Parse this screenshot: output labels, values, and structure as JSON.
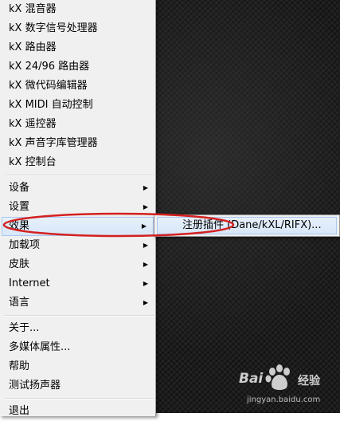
{
  "menu": {
    "tools": [
      {
        "label": "kX 混音器"
      },
      {
        "label": "kX 数字信号处理器"
      },
      {
        "label": "kX 路由器"
      },
      {
        "label": "kX 24/96 路由器"
      },
      {
        "label": "kX 微代码编辑器"
      },
      {
        "label": "kX MIDI 自动控制"
      },
      {
        "label": "kX 遥控器"
      },
      {
        "label": "kX 声音字库管理器"
      },
      {
        "label": "kX 控制台"
      }
    ],
    "submenus": [
      {
        "label": "设备"
      },
      {
        "label": "设置"
      },
      {
        "label": "效果"
      },
      {
        "label": "加载项"
      },
      {
        "label": "皮肤"
      },
      {
        "label": "Internet"
      },
      {
        "label": "语言"
      }
    ],
    "misc": [
      {
        "label": "关于..."
      },
      {
        "label": "多媒体属性..."
      },
      {
        "label": "帮助"
      },
      {
        "label": "测试扬声器"
      }
    ],
    "exit": {
      "label": "退出"
    },
    "submenu_arrow": "▶",
    "highlighted": "效果"
  },
  "effects_submenu": {
    "item_label": "注册插件 (Dane/kXL/RIFX)..."
  },
  "watermark": {
    "brand_latin": "Bai",
    "brand_cn": "经验",
    "url": "jingyan.baidu.com",
    "icon": "baidu-paw-icon"
  },
  "colors": {
    "menu_bg": "#f0f0f0",
    "highlight": "#d7e6f8",
    "highlight_border": "#a9c8ef",
    "callout": "#d42020",
    "desktop": "#1c1c1c"
  }
}
